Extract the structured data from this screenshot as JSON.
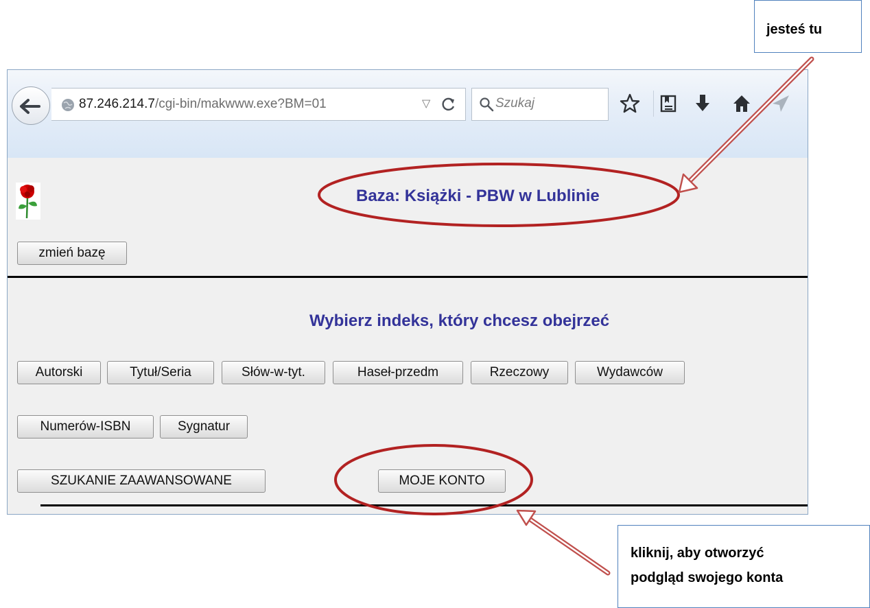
{
  "browser": {
    "url_host": "87.246.214.7",
    "url_path": "/cgi-bin/makwww.exe?BM=01",
    "search_placeholder": "Szukaj"
  },
  "page": {
    "base_title": "Baza: Książki - PBW w Lublinie",
    "change_base_label": "zmień bazę",
    "index_prompt": "Wybierz indeks, który chcesz obejrzeć",
    "index_buttons_row1": [
      "Autorski",
      "Tytuł/Seria",
      "Słów-w-tyt.",
      "Haseł-przedm",
      "Rzeczowy",
      "Wydawców"
    ],
    "index_buttons_row2": [
      "Numerów-ISBN",
      "Sygnatur"
    ],
    "advanced_search_label": "SZUKANIE ZAAWANSOWANE",
    "my_account_label": "MOJE KONTO"
  },
  "annotations": {
    "here_label": "jesteś tu",
    "click_line1": "kliknij, aby otworzyć",
    "click_line2": "podgląd swojego konta",
    "highlight_color": "#b22222",
    "arrow_color": "#c0504d",
    "callout_border_color": "#4f81bd"
  },
  "colors": {
    "heading": "#333399",
    "page_background": "#f0f0f0"
  }
}
